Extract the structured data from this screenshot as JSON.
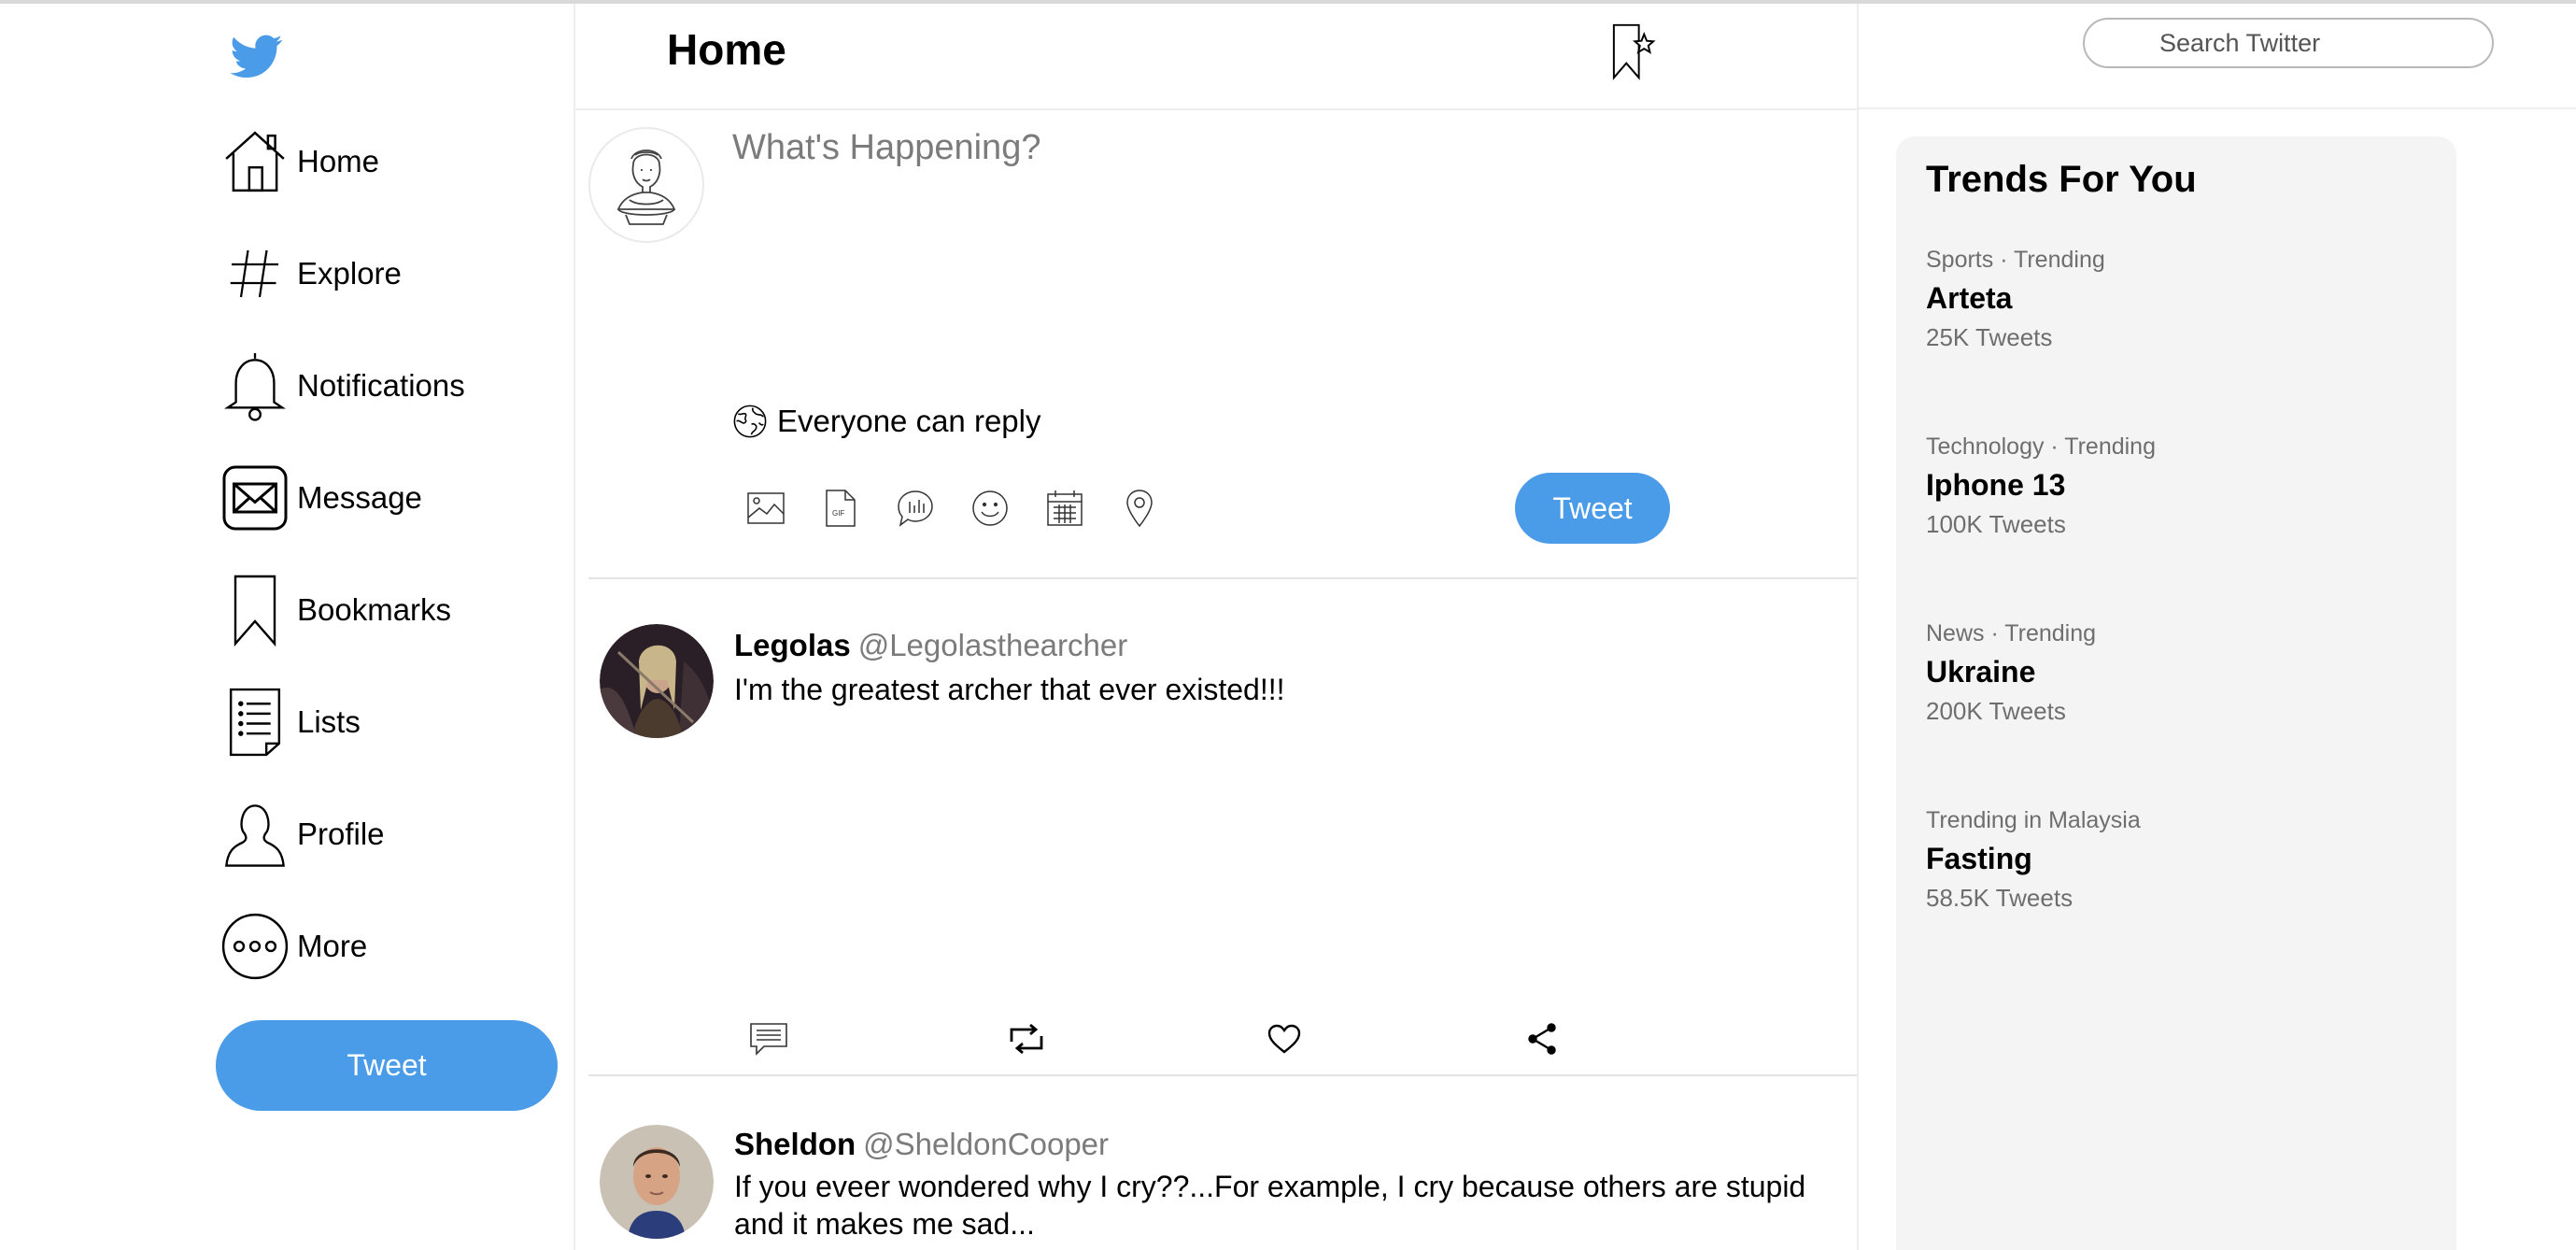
{
  "sidebar": {
    "logo": "twitter-bird",
    "nav": [
      {
        "label": "Home",
        "icon": "home-icon"
      },
      {
        "label": "Explore",
        "icon": "hashtag-icon"
      },
      {
        "label": "Notifications",
        "icon": "bell-icon"
      },
      {
        "label": "Message",
        "icon": "envelope-icon"
      },
      {
        "label": "Bookmarks",
        "icon": "bookmark-icon"
      },
      {
        "label": "Lists",
        "icon": "list-icon"
      },
      {
        "label": "Profile",
        "icon": "person-icon"
      },
      {
        "label": "More",
        "icon": "more-icon"
      }
    ],
    "tweet_button": "Tweet"
  },
  "header": {
    "title": "Home"
  },
  "compose": {
    "placeholder": "What's Happening?",
    "reply_setting": "Everyone can reply",
    "tools": [
      "image-icon",
      "gif-icon",
      "poll-icon",
      "emoji-icon",
      "schedule-icon",
      "location-icon"
    ],
    "tweet_button": "Tweet"
  },
  "tweets": [
    {
      "name": "Legolas",
      "handle": "@Legolasthearcher",
      "text": "I'm the greatest archer that ever existed!!!"
    },
    {
      "name": "Sheldon",
      "handle": "@SheldonCooper",
      "text": "If you eveer wondered why I cry??...For example, I cry because others are stupid and it makes me sad..."
    }
  ],
  "search": {
    "placeholder": "Search Twitter"
  },
  "trends": {
    "title": "Trends For You",
    "items": [
      {
        "meta": "Sports · Trending",
        "topic": "Arteta",
        "count": "25K Tweets"
      },
      {
        "meta": "Technology · Trending",
        "topic": "Iphone 13",
        "count": "100K Tweets"
      },
      {
        "meta": "News · Trending",
        "topic": "Ukraine",
        "count": "200K Tweets"
      },
      {
        "meta": "Trending in Malaysia",
        "topic": "Fasting",
        "count": "58.5K Tweets"
      }
    ]
  },
  "colors": {
    "accent": "#4a9be8",
    "muted_text": "#7b7b7b",
    "panel": "#f4f4f4"
  }
}
